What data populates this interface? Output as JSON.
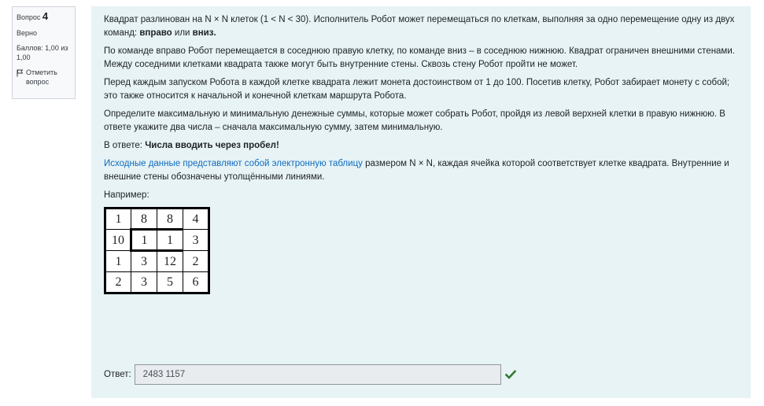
{
  "info": {
    "question_prefix": "Вопрос",
    "question_number": "4",
    "state": "Верно",
    "grade": "Баллов: 1,00 из 1,00",
    "flag_label": "Отметить вопрос"
  },
  "question": {
    "p1_text": "Квадрат разлинован на N × N клеток (1 < N < 30). Исполнитель Робот может перемещаться по клеткам, выполняя за одно перемещение одну из двух команд: ",
    "p1_cmd1": "вправо",
    "p1_or": " или ",
    "p1_cmd2": "вниз.",
    "p2": "По команде вправо  Робот перемещается в соседнюю правую клетку, по команде вниз  – в соседнюю нижнюю. Квадрат ограничен внешними стенами. Между соседними клетками квадрата также могут быть внутренние стены. Сквозь стену Робот пройти не может.",
    "p3": "Перед каждым запуском Робота в каждой клетке квадрата лежит монета достоинством от 1 до 100. Посетив клетку, Робот забирает монету с собой; это также относится к начальной и конечной клеткам маршрута Робота.",
    "p4": "Определите максимальную и минимальную денежные суммы, которые может собрать Робот, пройдя из левой верхней клетки в правую нижнюю. В ответе укажите два числа – сначала максимальную сумму, затем минимальную.",
    "p5_prefix": "В ответе: ",
    "p5_bold": "Числа вводить через пробел!",
    "p6_link": "Исходные данные представляют собой электронную таблицу",
    "p6_rest": " размером N × N, каждая ячейка которой соответствует клетке квадрата. Внутренние и внешние стены обозначены утолщёнными линиями.",
    "example_label": "Например:",
    "grid": [
      [
        "1",
        "8",
        "8",
        "4"
      ],
      [
        "10",
        "1",
        "1",
        "3"
      ],
      [
        "1",
        "3",
        "12",
        "2"
      ],
      [
        "2",
        "3",
        "5",
        "6"
      ]
    ]
  },
  "answer": {
    "label": "Ответ:",
    "value": "2483 1157",
    "status_color": "#357a32"
  }
}
